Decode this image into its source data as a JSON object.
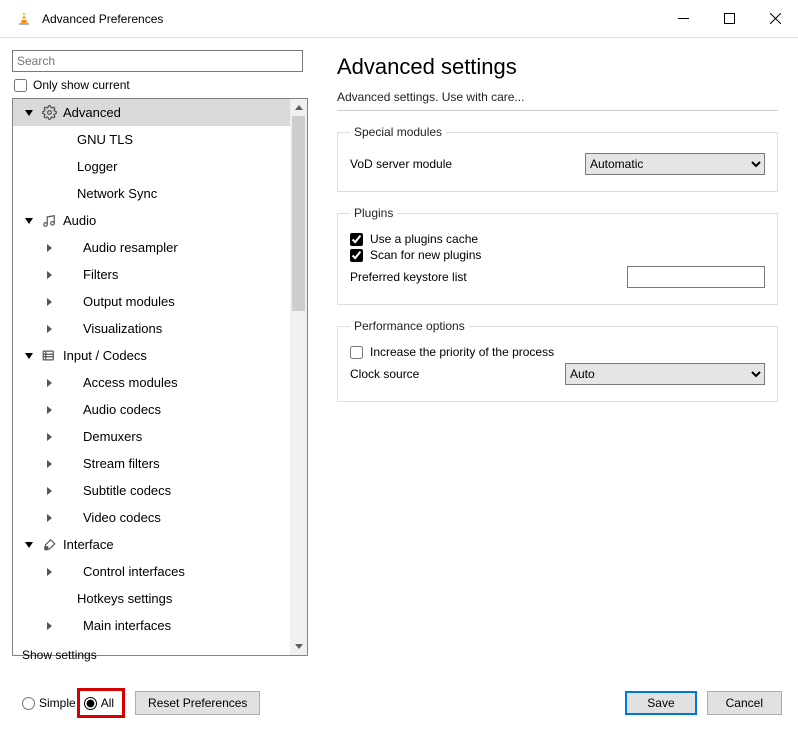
{
  "window": {
    "title": "Advanced Preferences"
  },
  "left": {
    "search_placeholder": "Search",
    "only_show_current": "Only show current",
    "tree": {
      "advanced": "Advanced",
      "gnu_tls": "GNU TLS",
      "logger": "Logger",
      "network_sync": "Network Sync",
      "audio": "Audio",
      "audio_resampler": "Audio resampler",
      "filters": "Filters",
      "output_modules": "Output modules",
      "visualizations": "Visualizations",
      "input_codecs": "Input / Codecs",
      "access_modules": "Access modules",
      "audio_codecs": "Audio codecs",
      "demuxers": "Demuxers",
      "stream_filters": "Stream filters",
      "subtitle_codecs": "Subtitle codecs",
      "video_codecs": "Video codecs",
      "interface": "Interface",
      "control_interfaces": "Control interfaces",
      "hotkeys_settings": "Hotkeys settings",
      "main_interfaces": "Main interfaces"
    }
  },
  "right": {
    "heading": "Advanced settings",
    "subtitle": "Advanced settings. Use with care...",
    "special_modules": {
      "legend": "Special modules",
      "vod_label": "VoD server module",
      "vod_value": "Automatic"
    },
    "plugins": {
      "legend": "Plugins",
      "use_cache": "Use a plugins cache",
      "scan_new": "Scan for new plugins",
      "keystore_label": "Preferred keystore list",
      "keystore_value": ""
    },
    "perf": {
      "legend": "Performance options",
      "increase_priority": "Increase the priority of the process",
      "clock_label": "Clock source",
      "clock_value": "Auto"
    }
  },
  "footer": {
    "show_settings": "Show settings",
    "simple": "Simple",
    "all": "All",
    "reset": "Reset Preferences",
    "save": "Save",
    "cancel": "Cancel"
  }
}
